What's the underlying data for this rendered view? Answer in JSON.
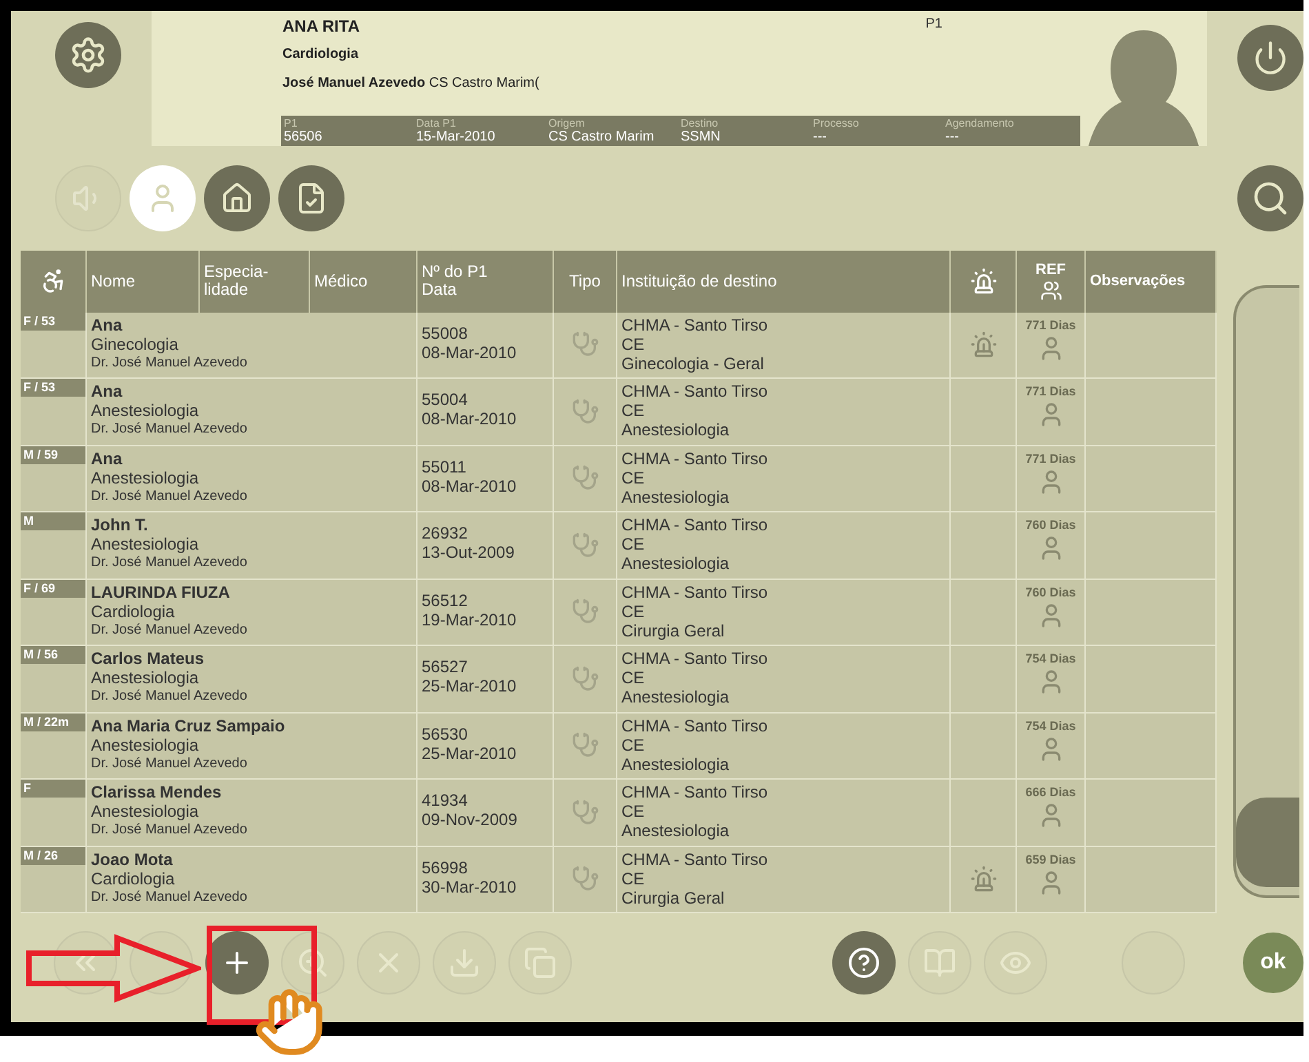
{
  "patient": {
    "name": "ANA RITA",
    "p1_label": "P1",
    "specialty": "Cardiologia",
    "line": "**José Manuel Azevedo** CS Castro Marim(",
    "fields": [
      {
        "label": "P1",
        "value": "56506"
      },
      {
        "label": "Data P1",
        "value": "15-Mar-2010"
      },
      {
        "label": "Origem",
        "value": "CS Castro Marim"
      },
      {
        "label": "Destino",
        "value": "SSMN"
      },
      {
        "label": "Processo",
        "value": "---"
      },
      {
        "label": "Agendamento",
        "value": "---"
      }
    ]
  },
  "view_buttons": [
    {
      "kind": "sound",
      "selected": false,
      "disabled": true
    },
    {
      "kind": "patient",
      "selected": true,
      "disabled": false
    },
    {
      "kind": "home",
      "selected": false,
      "disabled": false
    },
    {
      "kind": "documents",
      "selected": false,
      "disabled": false
    }
  ],
  "table": {
    "columns": [
      "Nome",
      "Especia-\nlidade",
      "Médico",
      "Nº do P1\nData",
      "Tipo",
      "Instituição de destino",
      "REF",
      "Observações"
    ],
    "rows": [
      {
        "badge": "F / 53",
        "name": "Ana",
        "specialty": "Ginecologia",
        "doctor": "Dr. José Manuel Azevedo",
        "number": "55008",
        "date": "08-Mar-2010",
        "institution": "CHMA - Santo Tirso",
        "type": "CE",
        "service": "Ginecologia - Geral",
        "alert": true,
        "days": "771 Dias"
      },
      {
        "badge": "F / 53",
        "name": "Ana",
        "specialty": "Anestesiologia",
        "doctor": "Dr. José Manuel Azevedo",
        "number": "55004",
        "date": "08-Mar-2010",
        "institution": "CHMA - Santo Tirso",
        "type": "CE",
        "service": "Anestesiologia",
        "alert": false,
        "days": "771 Dias"
      },
      {
        "badge": "M / 59",
        "name": "Ana",
        "specialty": "Anestesiologia",
        "doctor": "Dr. José Manuel Azevedo",
        "number": "55011",
        "date": "08-Mar-2010",
        "institution": "CHMA - Santo Tirso",
        "type": "CE",
        "service": "Anestesiologia",
        "alert": false,
        "days": "771 Dias"
      },
      {
        "badge": "M",
        "name": "John T.",
        "specialty": "Anestesiologia",
        "doctor": "Dr. José Manuel Azevedo",
        "number": "26932",
        "date": "13-Out-2009",
        "institution": "CHMA - Santo Tirso",
        "type": "CE",
        "service": "Anestesiologia",
        "alert": false,
        "days": "760 Dias"
      },
      {
        "badge": "F / 69",
        "name": "LAURINDA FIUZA",
        "specialty": "Cardiologia",
        "doctor": "Dr. José Manuel Azevedo",
        "number": "56512",
        "date": "19-Mar-2010",
        "institution": "CHMA - Santo Tirso",
        "type": "CE",
        "service": "Cirurgia Geral",
        "alert": false,
        "days": "760 Dias"
      },
      {
        "badge": "M / 56",
        "name": "Carlos Mateus",
        "specialty": "Anestesiologia",
        "doctor": "Dr. José Manuel Azevedo",
        "number": "56527",
        "date": "25-Mar-2010",
        "institution": "CHMA - Santo Tirso",
        "type": "CE",
        "service": "Anestesiologia",
        "alert": false,
        "days": "754 Dias"
      },
      {
        "badge": "M / 22m",
        "name": "Ana Maria Cruz Sampaio",
        "specialty": "Anestesiologia",
        "doctor": "Dr. José Manuel Azevedo",
        "number": "56530",
        "date": "25-Mar-2010",
        "institution": "CHMA - Santo Tirso",
        "type": "CE",
        "service": "Anestesiologia",
        "alert": false,
        "days": "754 Dias"
      },
      {
        "badge": "F",
        "name": "Clarissa Mendes",
        "specialty": "Anestesiologia",
        "doctor": "Dr. José Manuel Azevedo",
        "number": "41934",
        "date": "09-Nov-2009",
        "institution": "CHMA - Santo Tirso",
        "type": "CE",
        "service": "Anestesiologia",
        "alert": false,
        "days": "666 Dias"
      },
      {
        "badge": "M / 26",
        "name": "Joao Mota",
        "specialty": "Cardiologia",
        "doctor": "Dr. José Manuel Azevedo",
        "number": "56998",
        "date": "30-Mar-2010",
        "institution": "CHMA - Santo Tirso",
        "type": "CE",
        "service": "Cirurgia Geral",
        "alert": true,
        "days": "659 Dias"
      }
    ]
  },
  "toolbar": [
    {
      "kind": "back",
      "disabled": true
    },
    {
      "kind": "blank",
      "disabled": true
    },
    {
      "kind": "add",
      "disabled": false
    },
    {
      "kind": "zoom",
      "disabled": true
    },
    {
      "kind": "delete",
      "disabled": true
    },
    {
      "kind": "download",
      "disabled": true
    },
    {
      "kind": "copy",
      "disabled": true
    },
    {
      "kind": "help",
      "disabled": false
    },
    {
      "kind": "book",
      "disabled": true
    },
    {
      "kind": "eye",
      "disabled": true
    },
    {
      "kind": "blank",
      "disabled": true
    }
  ],
  "ok_button": "ok"
}
